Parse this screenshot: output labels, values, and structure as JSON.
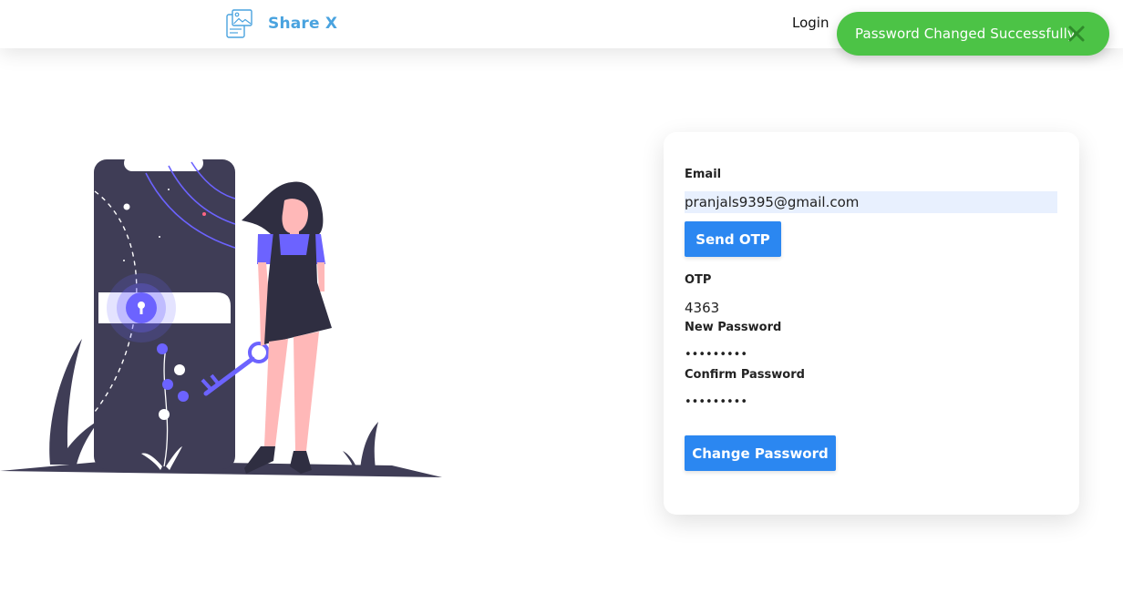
{
  "navbar": {
    "brand_name": "Share X",
    "login_label": "Login"
  },
  "toast": {
    "message": "Password Changed Successfully",
    "close_icon": "close-icon",
    "color": "#4cc346"
  },
  "form": {
    "email_label": "Email",
    "email_value": "pranjals9395@gmail.com",
    "send_otp_label": "Send OTP",
    "otp_label": "OTP",
    "otp_value": "4363",
    "new_password_label": "New Password",
    "new_password_value": "•••••••••",
    "confirm_password_label": "Confirm Password",
    "confirm_password_value": "•••••••••",
    "change_password_label": "Change Password"
  },
  "colors": {
    "accent": "#2b87f1",
    "brand": "#4aa3df",
    "illustration_dark": "#3f3d56",
    "illustration_purple": "#6c63ff",
    "skin": "#ffb8b8"
  }
}
